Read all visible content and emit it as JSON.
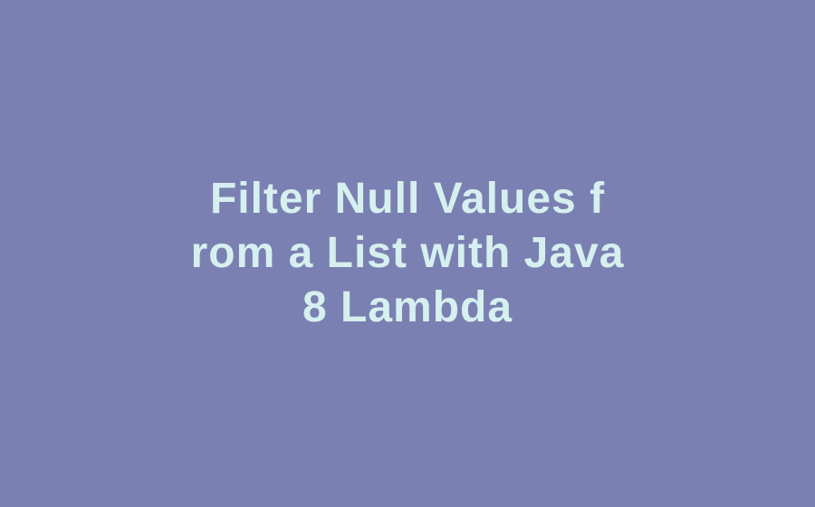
{
  "heading": {
    "line1": "Filter Null Values f",
    "line2": "rom a List with Java",
    "line3": "8 Lambda"
  },
  "colors": {
    "background": "#7b80b2",
    "text": "#d6f0ef"
  }
}
